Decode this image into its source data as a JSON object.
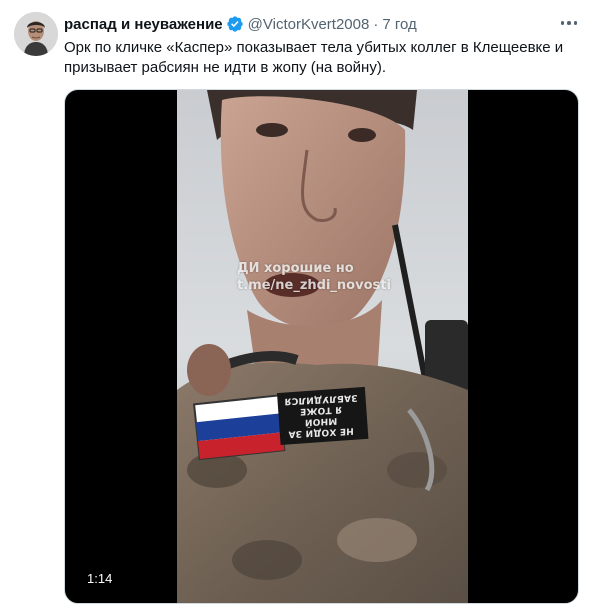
{
  "tweet": {
    "display_name": "распад и неуважение",
    "handle": "@VictorKvert2008",
    "separator": "·",
    "time": "7 год",
    "text": "Орк по кличке «Каспер» показывает тела убитых коллег в Клещеевке и призывает рабсиян не идти в жопу (на войну).",
    "more_icon": "more-horizontal-icon",
    "verified_icon": "verified-badge-icon"
  },
  "media": {
    "type": "video",
    "duration": "1:14",
    "watermark_line1": "ДИ хорошие но",
    "watermark_line2": "t.me/ne_zhdi_novosti",
    "patch_line1": "НЕ ХОДИ ЗА МНОЙ",
    "patch_line2": "Я ТОЖЕ",
    "patch_line3": "ЗАБЛУДИЛСЯ"
  },
  "colors": {
    "text_primary": "#0f1419",
    "text_secondary": "#536471",
    "verified_blue": "#1d9bf0",
    "media_background": "#000000"
  }
}
